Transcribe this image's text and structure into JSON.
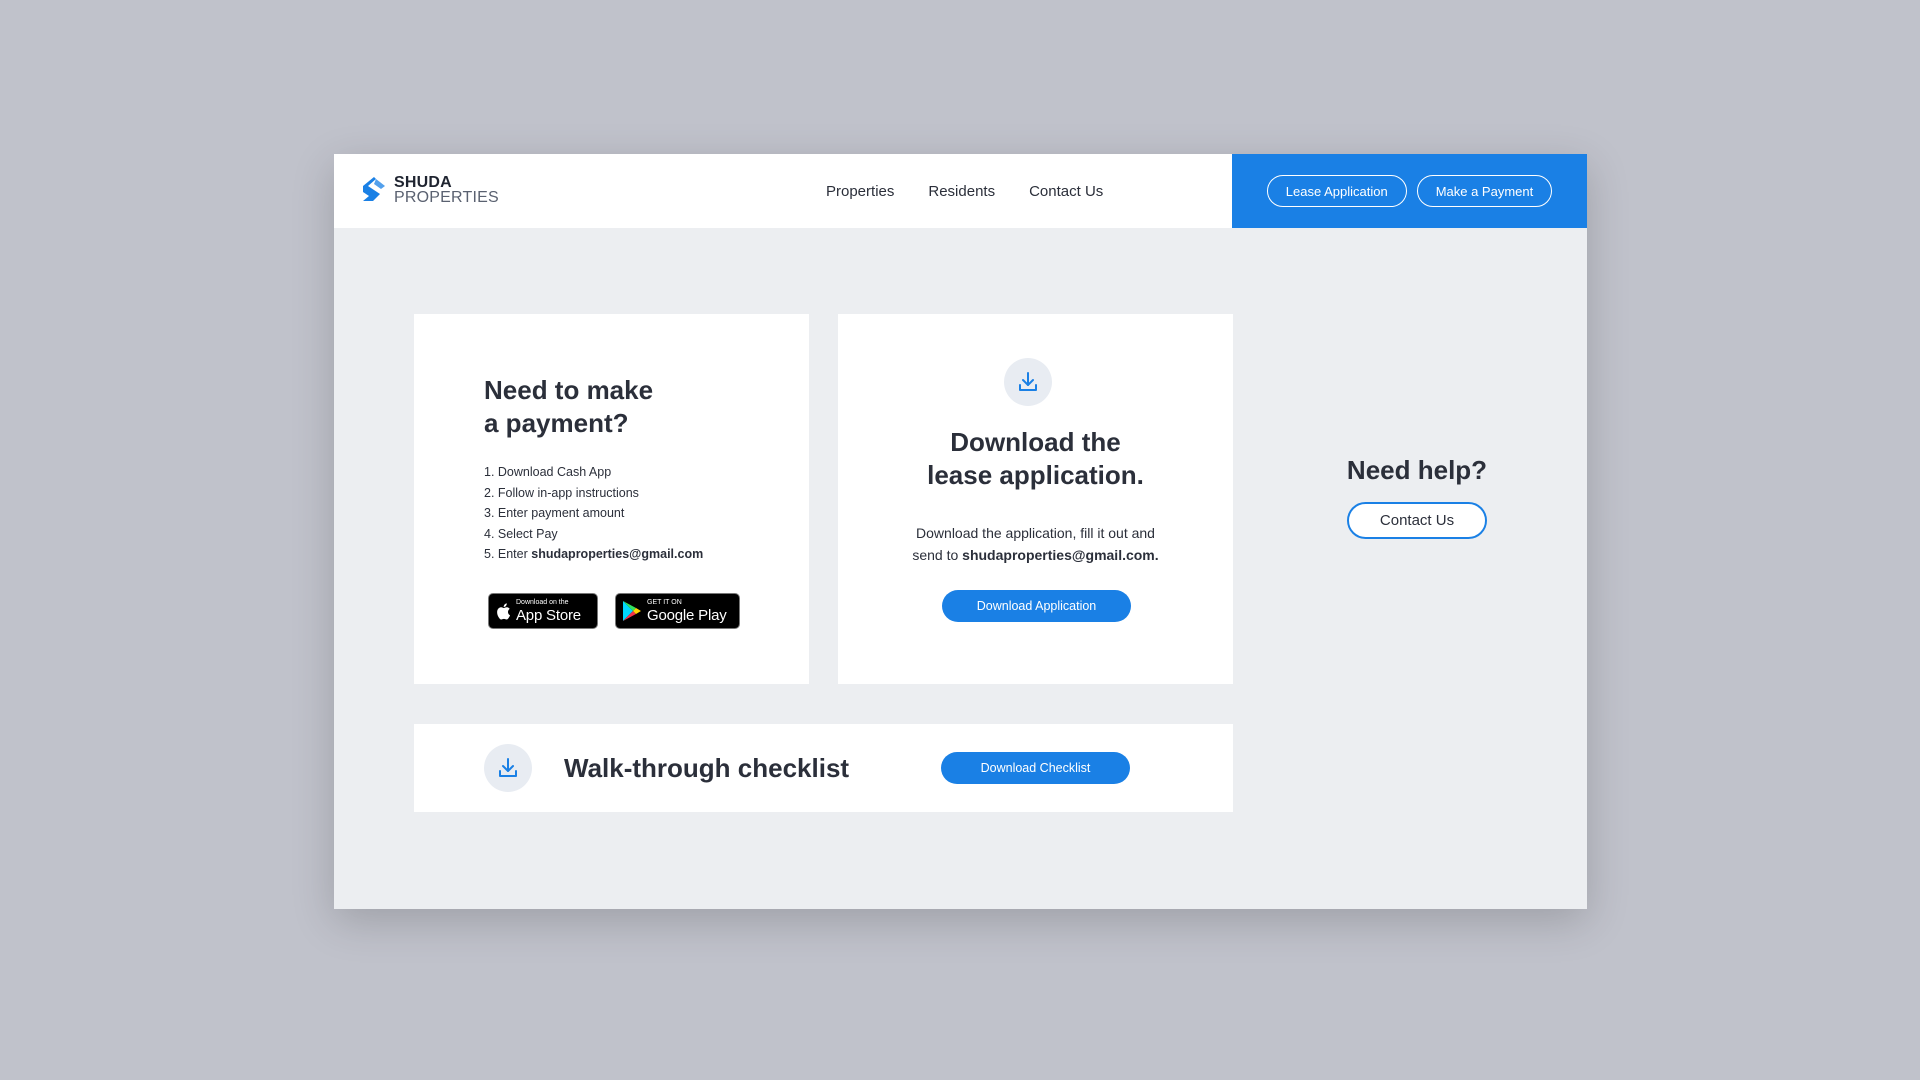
{
  "brand": {
    "name_top": "SHUDA",
    "name_bottom": "PROPERTIES",
    "color": "#1a80e5"
  },
  "nav": {
    "items": [
      {
        "label": "Properties"
      },
      {
        "label": "Residents"
      },
      {
        "label": "Contact Us"
      }
    ]
  },
  "header_cta": {
    "lease_label": "Lease Application",
    "payment_label": "Make a Payment"
  },
  "payment_card": {
    "title_line1": "Need to make",
    "title_line2": "a payment?",
    "steps": [
      "1. Download Cash App",
      "2. Follow in-app instructions",
      "3. Enter payment amount",
      "4. Select Pay"
    ],
    "step5_prefix": "5. Enter ",
    "step5_email": "shudaproperties@gmail.com",
    "app_store": {
      "small": "Download on the",
      "big": "App Store",
      "icon": "apple-icon"
    },
    "google_play": {
      "small": "GET IT ON",
      "big": "Google Play",
      "icon": "google-play-icon"
    }
  },
  "lease_card": {
    "icon": "download-icon",
    "title_line1": "Download the",
    "title_line2": "lease application.",
    "desc_line1": "Download the application, fill it out and",
    "desc_prefix": "send to ",
    "desc_email": "shudaproperties@gmail.com.",
    "button_label": "Download Application"
  },
  "walkthrough": {
    "icon": "download-icon",
    "title": "Walk-through checklist",
    "button_label": "Download Checklist"
  },
  "help": {
    "title": "Need help?",
    "button_label": "Contact Us"
  }
}
